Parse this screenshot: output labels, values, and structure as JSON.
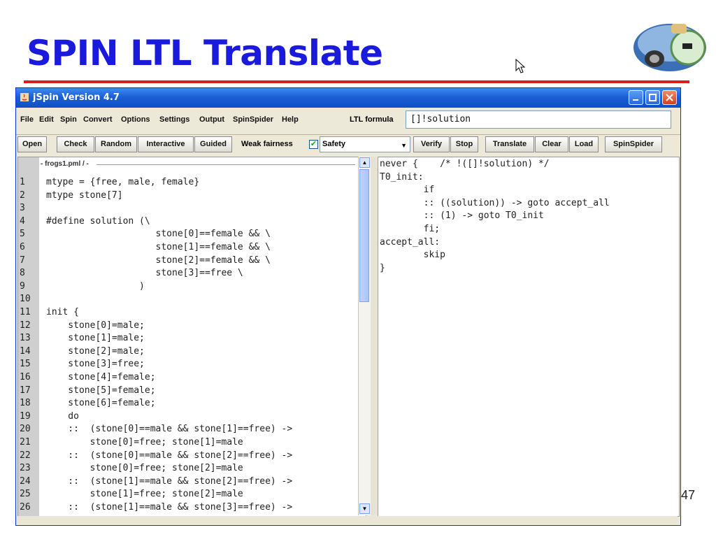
{
  "slide": {
    "title": "SPIN LTL Translate",
    "page_number": "47"
  },
  "window": {
    "title": "jSpin Version 4.7"
  },
  "menu": {
    "items": [
      "File",
      "Edit",
      "Spin",
      "Convert",
      "Options",
      "Settings",
      "Output",
      "SpinSpider",
      "Help"
    ],
    "ltl_label": "LTL formula",
    "ltl_value": "[]!solution"
  },
  "toolbar": {
    "open": "Open",
    "check": "Check",
    "random": "Random",
    "interactive": "Interactive",
    "guided": "Guided",
    "weak_fairness": "Weak fairness",
    "weak_fairness_checked": true,
    "mode": "Safety",
    "verify": "Verify",
    "stop": "Stop",
    "translate": "Translate",
    "clear": "Clear",
    "load": "Load",
    "spinspider": "SpinSpider"
  },
  "editor": {
    "file": "- frogs1.pml / -",
    "lines": [
      "mtype = {free, male, female}",
      "mtype stone[7]",
      "",
      "#define solution (\\",
      "                    stone[0]==female && \\",
      "                    stone[1]==female && \\",
      "                    stone[2]==female && \\",
      "                    stone[3]==free \\",
      "                 )",
      "",
      "init {",
      "    stone[0]=male;",
      "    stone[1]=male;",
      "    stone[2]=male;",
      "    stone[3]=free;",
      "    stone[4]=female;",
      "    stone[5]=female;",
      "    stone[6]=female;",
      "    do",
      "    ::  (stone[0]==male && stone[1]==free) ->",
      "        stone[0]=free; stone[1]=male",
      "    ::  (stone[0]==male && stone[2]==free) ->",
      "        stone[0]=free; stone[2]=male",
      "    ::  (stone[1]==male && stone[2]==free) ->",
      "        stone[1]=free; stone[2]=male",
      "    ::  (stone[1]==male && stone[3]==free) ->"
    ]
  },
  "output": {
    "lines": [
      "never {    /* !([]!solution) */",
      "T0_init:",
      "        if",
      "        :: ((solution)) -> goto accept_all",
      "        :: (1) -> goto T0_init",
      "        fi;",
      "accept_all:",
      "        skip",
      "}"
    ]
  },
  "colors": {
    "title": "#1a1adc",
    "rule": "#d81e1e",
    "titlebar": "#1b5fd6"
  }
}
